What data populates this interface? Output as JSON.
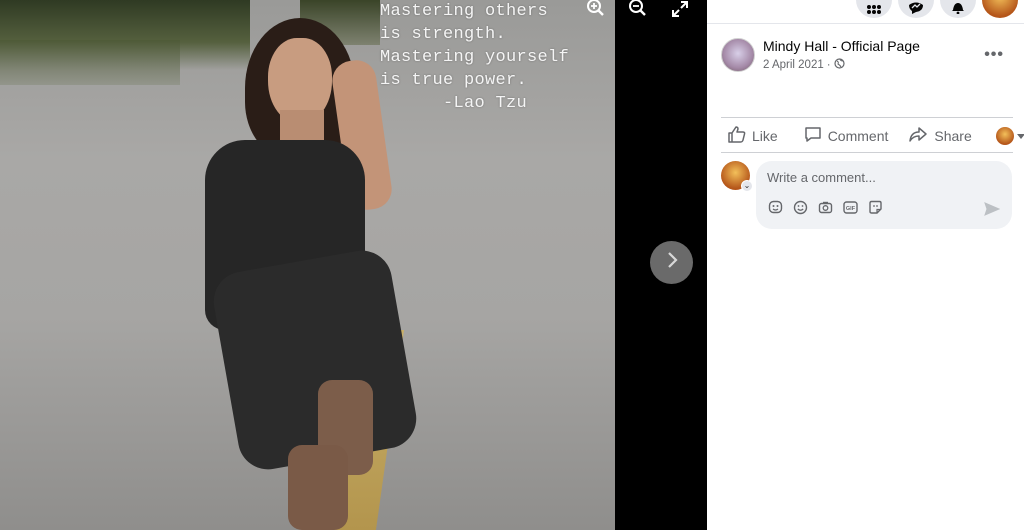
{
  "viewer": {
    "quote_text": "Mastering others\nis strength.\nMastering yourself\nis true power.\n      -Lao Tzu",
    "icons": [
      "zoom-in-icon",
      "zoom-out-icon",
      "fullscreen-icon"
    ],
    "next_icon": "chevron-right-icon"
  },
  "top_nav": {
    "icons": [
      "menu-grid-icon",
      "messenger-icon",
      "notifications-icon",
      "account-avatar"
    ]
  },
  "post": {
    "author": "Mindy Hall - Official Page",
    "date": "2 April 2021",
    "separator": "·",
    "privacy_icon": "globe-icon",
    "more_label": "•••"
  },
  "actions": {
    "like_label": "Like",
    "comment_label": "Comment",
    "share_label": "Share"
  },
  "comment": {
    "placeholder": "Write a comment...",
    "tools": [
      "sticker-icon",
      "emoji-icon",
      "camera-icon",
      "gif-icon",
      "avatar-sticker-icon"
    ],
    "send_icon": "send-icon"
  },
  "colors": {
    "panel_bg": "#ffffff",
    "comment_bg": "#f0f2f5",
    "secondary_text": "#65676b",
    "primary_text": "#050505"
  }
}
